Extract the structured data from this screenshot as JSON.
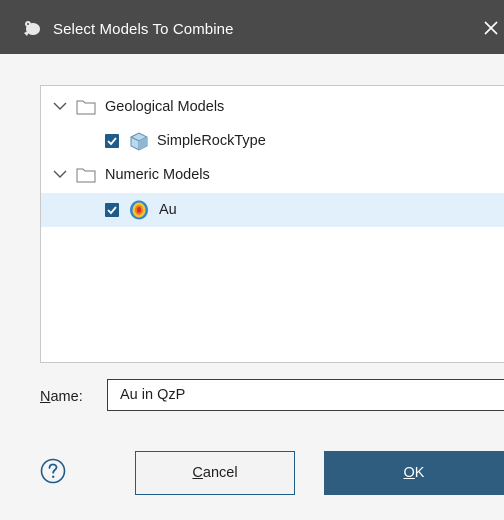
{
  "window": {
    "title": "Select Models To Combine",
    "app_icon": "leapfrog-logo-icon",
    "close_icon": "close-icon"
  },
  "tree": {
    "groups": [
      {
        "label": "Geological Models",
        "expanded": true,
        "icon": "folder-icon",
        "items": [
          {
            "label": "SimpleRockType",
            "checked": true,
            "selected": false,
            "icon": "geological-model-icon"
          }
        ]
      },
      {
        "label": "Numeric Models",
        "expanded": true,
        "icon": "folder-icon",
        "items": [
          {
            "label": "Au",
            "checked": true,
            "selected": true,
            "icon": "numeric-model-icon"
          }
        ]
      }
    ]
  },
  "form": {
    "name_label_mnemonic": "N",
    "name_label_rest": "ame:",
    "name_value": "Au in QzP"
  },
  "buttons": {
    "help_icon": "help-icon",
    "cancel_mnemonic": "C",
    "cancel_rest": "ancel",
    "ok_mnemonic": "O",
    "ok_rest": "K"
  },
  "colors": {
    "titlebar": "#4a4a4a",
    "selection": "#e2f0fb",
    "ok_button": "#2e5d7f",
    "checkbox": "#1f5c8a"
  }
}
